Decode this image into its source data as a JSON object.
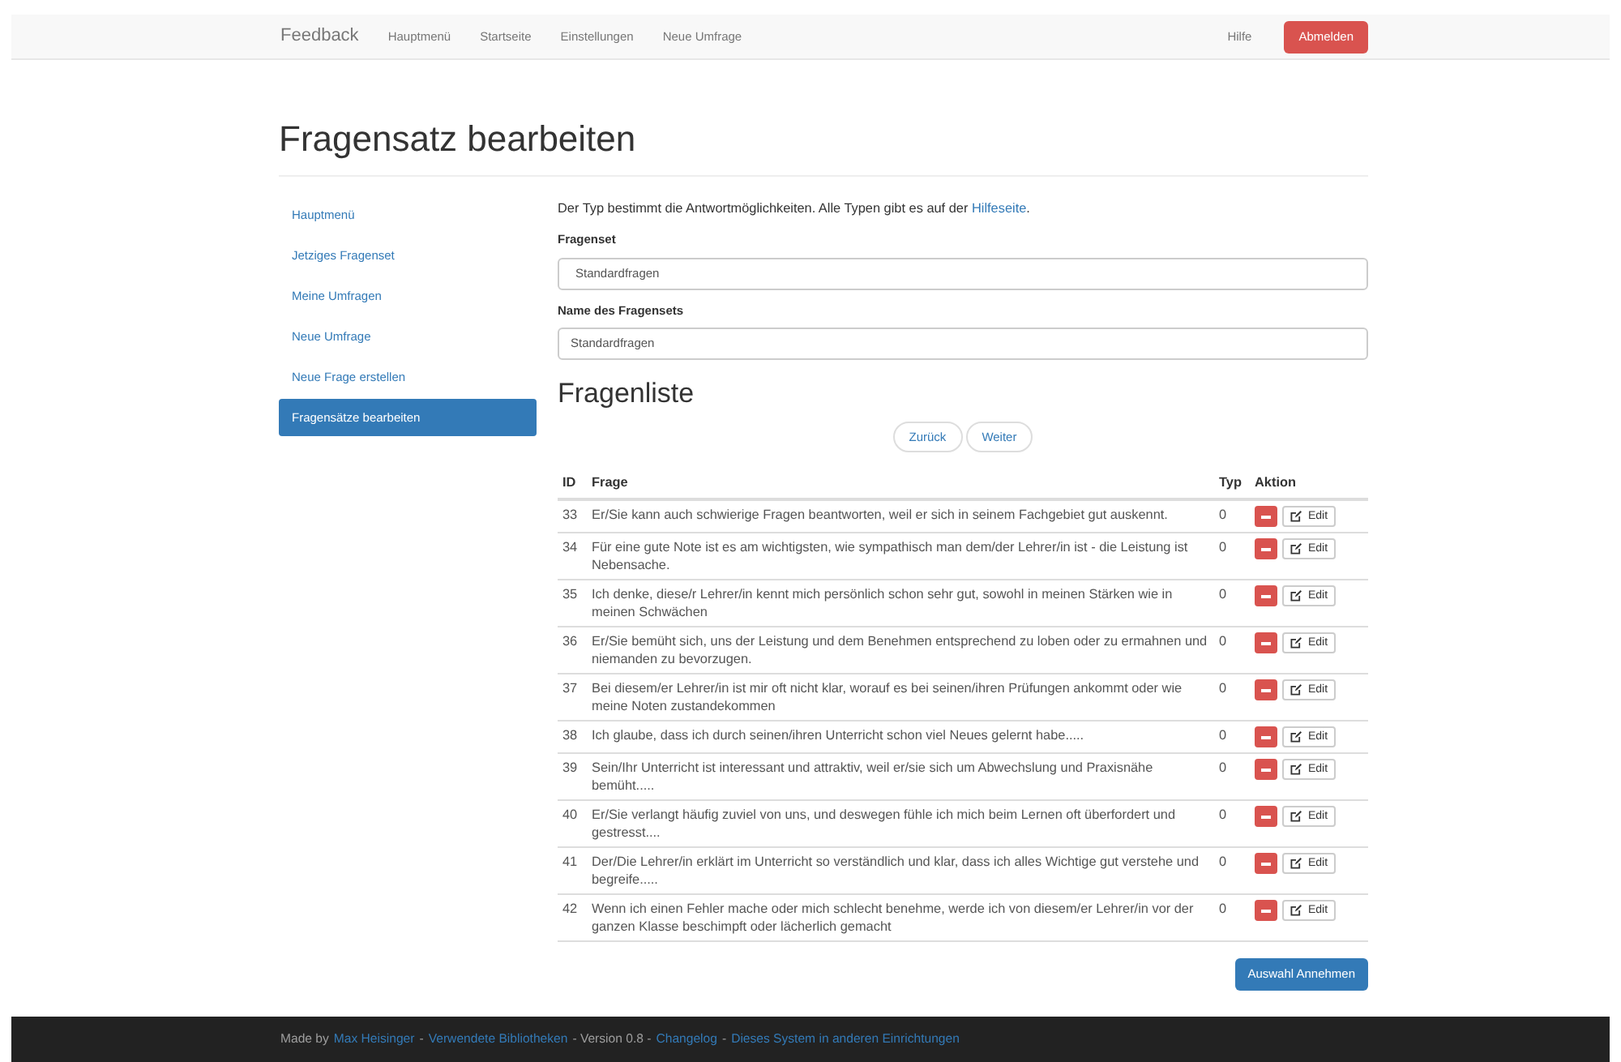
{
  "navbar": {
    "brand": "Feedback",
    "links": [
      "Hauptmenü",
      "Startseite",
      "Einstellungen",
      "Neue Umfrage"
    ],
    "help": "Hilfe",
    "logout": "Abmelden"
  },
  "title": "Fragensatz bearbeiten",
  "sidebar": {
    "items": [
      {
        "label": "Hauptmenü",
        "selected": false
      },
      {
        "label": "Jetziges Fragenset",
        "selected": false
      },
      {
        "label": "Meine Umfragen",
        "selected": false
      },
      {
        "label": "Neue Umfrage",
        "selected": false
      },
      {
        "label": "Neue Frage erstellen",
        "selected": false
      },
      {
        "label": "Fragensätze bearbeiten",
        "selected": true
      }
    ]
  },
  "intro": {
    "text": "Der Typ bestimmt die Antwortmöglichkeiten. Alle Typen gibt es auf der",
    "link": "Hilfeseite",
    "after": "."
  },
  "fields": [
    {
      "label": "Fragenset",
      "value": "Standardfragen",
      "kind": "select"
    },
    {
      "label": "Name des Fragensets",
      "value": "Standardfragen",
      "kind": "input"
    }
  ],
  "list_title": "Fragenliste",
  "pager": [
    "Zurück",
    "Weiter"
  ],
  "table": {
    "columns": [
      "ID",
      "Frage",
      "Typ",
      "Aktion"
    ],
    "rows": [
      {
        "id": "33",
        "question": "Er/Sie kann auch schwierige Fragen beantworten, weil er sich in seinem Fachgebiet gut auskennt.",
        "type": "0",
        "edit": "Edit"
      },
      {
        "id": "34",
        "question": "Für eine gute Note ist es am wichtigsten, wie sympathisch man dem/der Lehrer/in ist - die Leistung ist Nebensache.",
        "type": "0",
        "edit": "Edit"
      },
      {
        "id": "35",
        "question": "Ich denke, diese/r Lehrer/in kennt mich persönlich schon sehr gut, sowohl in meinen Stärken wie in meinen Schwächen",
        "type": "0",
        "edit": "Edit"
      },
      {
        "id": "36",
        "question": "Er/Sie bemüht sich, uns der Leistung und dem Benehmen entsprechend zu loben oder zu ermahnen und niemanden zu bevorzugen.",
        "type": "0",
        "edit": "Edit"
      },
      {
        "id": "37",
        "question": "Bei diesem/er Lehrer/in ist mir oft nicht klar, worauf es bei seinen/ihren Prüfungen ankommt oder wie meine Noten zustandekommen",
        "type": "0",
        "edit": "Edit"
      },
      {
        "id": "38",
        "question": "Ich glaube, dass ich durch seinen/ihren Unterricht schon viel Neues gelernt habe.....",
        "type": "0",
        "edit": "Edit"
      },
      {
        "id": "39",
        "question": "Sein/Ihr Unterricht ist interessant und attraktiv, weil er/sie sich um Abwechslung und Praxisnähe bemüht.....",
        "type": "0",
        "edit": "Edit"
      },
      {
        "id": "40",
        "question": "Er/Sie verlangt häufig zuviel von uns, und deswegen fühle ich mich beim Lernen oft überfordert und gestresst....",
        "type": "0",
        "edit": "Edit"
      },
      {
        "id": "41",
        "question": "Der/Die Lehrer/in erklärt im Unterricht so verständlich und klar, dass ich alles Wichtige gut verstehe und begreife.....",
        "type": "0",
        "edit": "Edit"
      },
      {
        "id": "42",
        "question": "Wenn ich einen Fehler mache oder mich schlecht benehme, werde ich von diesem/er Lehrer/in vor der ganzen Klasse beschimpft oder lächerlich gemacht",
        "type": "0",
        "edit": "Edit"
      }
    ]
  },
  "submit": "Auswahl Annehmen",
  "footer": [
    {
      "kind": "text",
      "text": "Made by"
    },
    {
      "kind": "link",
      "text": "Max Heisinger"
    },
    {
      "kind": "text",
      "text": "-"
    },
    {
      "kind": "link",
      "text": "Verwendete Bibliotheken"
    },
    {
      "kind": "text",
      "text": "- Version 0.8 -"
    },
    {
      "kind": "link",
      "text": "Changelog"
    },
    {
      "kind": "text",
      "text": "-"
    },
    {
      "kind": "link",
      "text": "Dieses System in anderen Einrichtungen"
    }
  ]
}
